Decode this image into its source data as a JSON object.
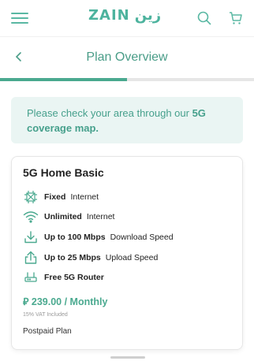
{
  "brand": {
    "name_latin": "ZAIN",
    "name_arabic": "زين",
    "color": "#4db39e"
  },
  "header": {
    "title": "Plan Overview",
    "progress": 0.5
  },
  "notice": {
    "text": "Please check your area through our ",
    "link_text": "5G coverage map."
  },
  "plan": {
    "name": "5G Home Basic",
    "features": [
      {
        "icon": "fixed-network-icon",
        "bold": "Fixed",
        "text": "Internet"
      },
      {
        "icon": "wifi-icon",
        "bold": "Unlimited",
        "text": "Internet"
      },
      {
        "icon": "download-icon",
        "bold": "Up to 100 Mbps",
        "text": "Download Speed"
      },
      {
        "icon": "upload-icon",
        "bold": "Up to 25 Mbps",
        "text": "Upload Speed"
      },
      {
        "icon": "router-icon",
        "bold": "Free 5G Router",
        "text": ""
      }
    ],
    "price": "⃁ 239.00 / Monthly",
    "vat_note": "15% VAT Included",
    "type": "Postpaid Plan"
  },
  "colors": {
    "accent": "#4aa98f",
    "notice_bg": "#eaf5f3"
  }
}
